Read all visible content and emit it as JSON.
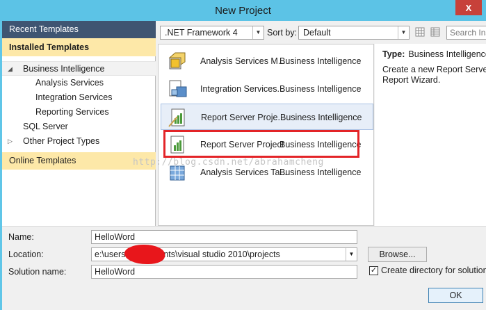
{
  "window": {
    "title": "New Project",
    "close_glyph": "X"
  },
  "left": {
    "recent": "Recent Templates",
    "installed": "Installed Templates",
    "tree": [
      {
        "label": "Business Intelligence",
        "arrow": "◢"
      },
      {
        "label": "Analysis Services"
      },
      {
        "label": "Integration Services"
      },
      {
        "label": "Reporting Services"
      },
      {
        "label": "SQL Server"
      },
      {
        "label": "Other Project Types",
        "arrow": "▷"
      }
    ],
    "online": "Online Templates"
  },
  "toolbar": {
    "framework": ".NET Framework 4",
    "sort_label": "Sort by:",
    "sort_value": "Default",
    "search_placeholder": "Search Ins"
  },
  "templates": [
    {
      "name": "Analysis Services M...",
      "category": "Business Intelligence",
      "icon": "analysis-cube-icon"
    },
    {
      "name": "Integration Services...",
      "category": "Business Intelligence",
      "icon": "integration-package-icon"
    },
    {
      "name": "Report Server Proje...",
      "category": "Business Intelligence",
      "icon": "report-wizard-icon"
    },
    {
      "name": "Report Server Project",
      "category": "Business Intelligence",
      "icon": "report-project-icon"
    },
    {
      "name": "Analysis Services Ta...",
      "category": "Business Intelligence",
      "icon": "tabular-grid-icon"
    }
  ],
  "watermark": "http://blog.csdn.net/abrahamcheng",
  "details": {
    "type_label": "Type:",
    "type_value": "Business Intelligence",
    "description": [
      "Create a new Report Server p",
      "Report Wizard."
    ]
  },
  "form": {
    "name_label": "Name:",
    "name_value": "HelloWord",
    "location_label": "Location:",
    "location_value": "e:\\users\\         \\documents\\visual studio 2010\\projects",
    "solution_label": "Solution name:",
    "solution_value": "HelloWord",
    "browse": "Browse...",
    "create_dir": "Create directory for solution",
    "create_dir_checked": true,
    "ok": "OK"
  },
  "colors": {
    "titlebar": "#5cc3e6",
    "left_header": "#3f5572",
    "highlight": "#fde8a8",
    "annotation_red": "#e32428"
  }
}
